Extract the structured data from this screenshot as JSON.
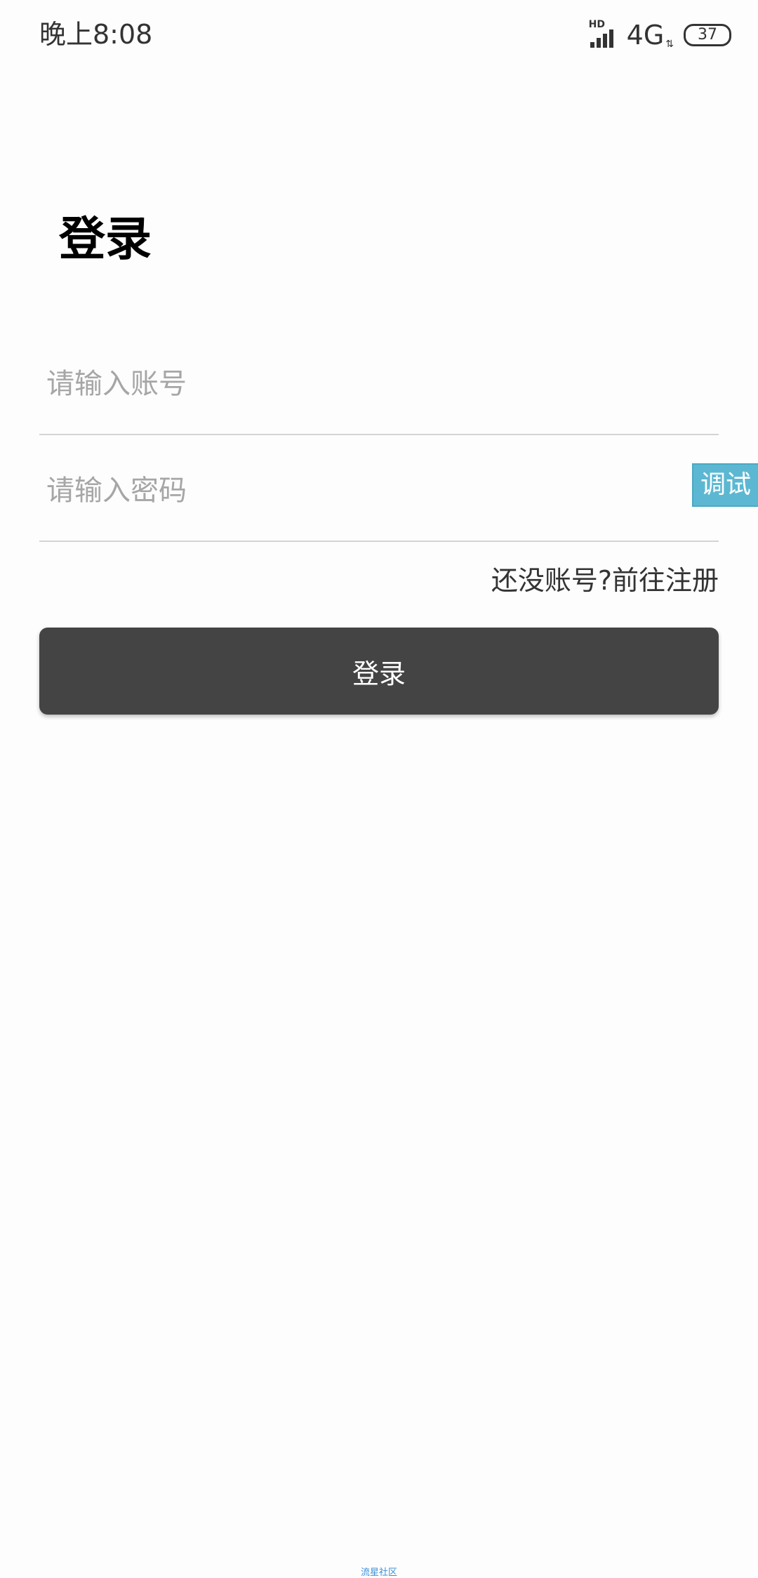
{
  "status_bar": {
    "time": "晚上8:08",
    "hd_label": "HD",
    "network": "4G",
    "network_arrows": "⇅",
    "battery": "37"
  },
  "page": {
    "title": "登录"
  },
  "form": {
    "account_placeholder": "请输入账号",
    "account_value": "",
    "password_placeholder": "请输入密码",
    "password_value": "",
    "register_link": "还没账号?前往注册",
    "login_button": "登录"
  },
  "debug_tab": {
    "label": "调试"
  },
  "footer": {
    "text": "流星社区"
  },
  "colors": {
    "button_bg": "#444444",
    "debug_tab_bg": "#5cb8d2",
    "footer_text": "#3a8fd8"
  }
}
